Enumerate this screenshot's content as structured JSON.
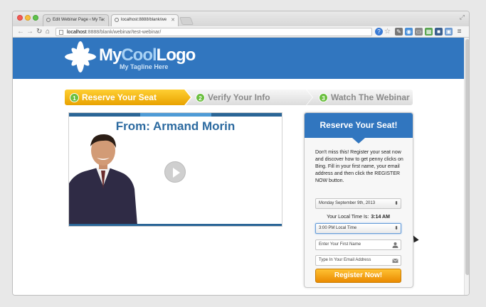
{
  "browser": {
    "tabs": [
      {
        "label": "Edit Webinar Page ‹ My Ta"
      },
      {
        "label": "localhost:8888/blank/we"
      }
    ],
    "url_host": "localhost",
    "url_rest": ":8888/blank/webinar/test-webinar/"
  },
  "site": {
    "logo_my": "My",
    "logo_cool": "Cool",
    "logo_logo": "Logo",
    "tagline": "My Tagline Here"
  },
  "steps": [
    {
      "num": "1",
      "label": "Reserve Your Seat"
    },
    {
      "num": "2",
      "label": "Verify Your Info"
    },
    {
      "num": "3",
      "label": "Watch The Webinar"
    }
  ],
  "video": {
    "title": "From: Armand Morin"
  },
  "form": {
    "heading": "Reserve Your Seat!",
    "description": "Don't miss this! Register your seat now and discover how to get penny clicks on Bing. Fill in your first name, your email address and then click the REGISTER NOW button.",
    "date_value": "Monday September 9th, 2013",
    "local_time_label": "Your Local Time Is:",
    "local_time_value": "3:14 AM",
    "time_value": "3:00 PM Local Time",
    "first_name_placeholder": "Enter Your First Name",
    "email_placeholder": "Type In Your Email Address",
    "submit_label": "Register Now!"
  },
  "colors": {
    "brand_blue": "#3176bf",
    "accent_orange": "#ea8a00",
    "step_green": "#6abf3e"
  }
}
